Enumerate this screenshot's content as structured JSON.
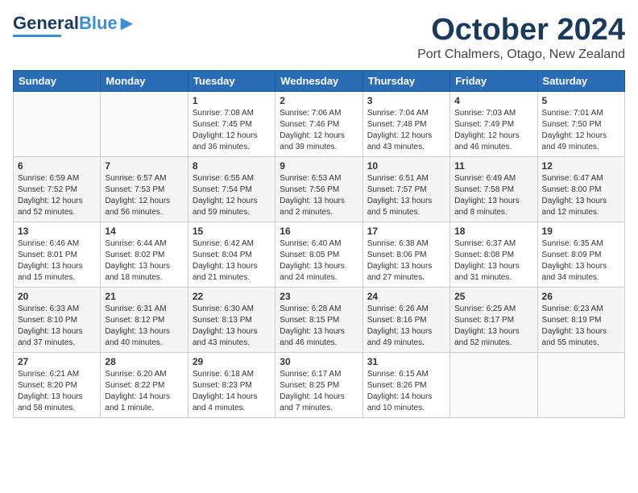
{
  "logo": {
    "general": "General",
    "blue": "Blue"
  },
  "title": "October 2024",
  "location": "Port Chalmers, Otago, New Zealand",
  "days_of_week": [
    "Sunday",
    "Monday",
    "Tuesday",
    "Wednesday",
    "Thursday",
    "Friday",
    "Saturday"
  ],
  "weeks": [
    [
      {
        "day": "",
        "info": ""
      },
      {
        "day": "",
        "info": ""
      },
      {
        "day": "1",
        "info": "Sunrise: 7:08 AM\nSunset: 7:45 PM\nDaylight: 12 hours\nand 36 minutes."
      },
      {
        "day": "2",
        "info": "Sunrise: 7:06 AM\nSunset: 7:46 PM\nDaylight: 12 hours\nand 39 minutes."
      },
      {
        "day": "3",
        "info": "Sunrise: 7:04 AM\nSunset: 7:48 PM\nDaylight: 12 hours\nand 43 minutes."
      },
      {
        "day": "4",
        "info": "Sunrise: 7:03 AM\nSunset: 7:49 PM\nDaylight: 12 hours\nand 46 minutes."
      },
      {
        "day": "5",
        "info": "Sunrise: 7:01 AM\nSunset: 7:50 PM\nDaylight: 12 hours\nand 49 minutes."
      }
    ],
    [
      {
        "day": "6",
        "info": "Sunrise: 6:59 AM\nSunset: 7:52 PM\nDaylight: 12 hours\nand 52 minutes."
      },
      {
        "day": "7",
        "info": "Sunrise: 6:57 AM\nSunset: 7:53 PM\nDaylight: 12 hours\nand 56 minutes."
      },
      {
        "day": "8",
        "info": "Sunrise: 6:55 AM\nSunset: 7:54 PM\nDaylight: 12 hours\nand 59 minutes."
      },
      {
        "day": "9",
        "info": "Sunrise: 6:53 AM\nSunset: 7:56 PM\nDaylight: 13 hours\nand 2 minutes."
      },
      {
        "day": "10",
        "info": "Sunrise: 6:51 AM\nSunset: 7:57 PM\nDaylight: 13 hours\nand 5 minutes."
      },
      {
        "day": "11",
        "info": "Sunrise: 6:49 AM\nSunset: 7:58 PM\nDaylight: 13 hours\nand 8 minutes."
      },
      {
        "day": "12",
        "info": "Sunrise: 6:47 AM\nSunset: 8:00 PM\nDaylight: 13 hours\nand 12 minutes."
      }
    ],
    [
      {
        "day": "13",
        "info": "Sunrise: 6:46 AM\nSunset: 8:01 PM\nDaylight: 13 hours\nand 15 minutes."
      },
      {
        "day": "14",
        "info": "Sunrise: 6:44 AM\nSunset: 8:02 PM\nDaylight: 13 hours\nand 18 minutes."
      },
      {
        "day": "15",
        "info": "Sunrise: 6:42 AM\nSunset: 8:04 PM\nDaylight: 13 hours\nand 21 minutes."
      },
      {
        "day": "16",
        "info": "Sunrise: 6:40 AM\nSunset: 8:05 PM\nDaylight: 13 hours\nand 24 minutes."
      },
      {
        "day": "17",
        "info": "Sunrise: 6:38 AM\nSunset: 8:06 PM\nDaylight: 13 hours\nand 27 minutes."
      },
      {
        "day": "18",
        "info": "Sunrise: 6:37 AM\nSunset: 8:08 PM\nDaylight: 13 hours\nand 31 minutes."
      },
      {
        "day": "19",
        "info": "Sunrise: 6:35 AM\nSunset: 8:09 PM\nDaylight: 13 hours\nand 34 minutes."
      }
    ],
    [
      {
        "day": "20",
        "info": "Sunrise: 6:33 AM\nSunset: 8:10 PM\nDaylight: 13 hours\nand 37 minutes."
      },
      {
        "day": "21",
        "info": "Sunrise: 6:31 AM\nSunset: 8:12 PM\nDaylight: 13 hours\nand 40 minutes."
      },
      {
        "day": "22",
        "info": "Sunrise: 6:30 AM\nSunset: 8:13 PM\nDaylight: 13 hours\nand 43 minutes."
      },
      {
        "day": "23",
        "info": "Sunrise: 6:28 AM\nSunset: 8:15 PM\nDaylight: 13 hours\nand 46 minutes."
      },
      {
        "day": "24",
        "info": "Sunrise: 6:26 AM\nSunset: 8:16 PM\nDaylight: 13 hours\nand 49 minutes."
      },
      {
        "day": "25",
        "info": "Sunrise: 6:25 AM\nSunset: 8:17 PM\nDaylight: 13 hours\nand 52 minutes."
      },
      {
        "day": "26",
        "info": "Sunrise: 6:23 AM\nSunset: 8:19 PM\nDaylight: 13 hours\nand 55 minutes."
      }
    ],
    [
      {
        "day": "27",
        "info": "Sunrise: 6:21 AM\nSunset: 8:20 PM\nDaylight: 13 hours\nand 58 minutes."
      },
      {
        "day": "28",
        "info": "Sunrise: 6:20 AM\nSunset: 8:22 PM\nDaylight: 14 hours\nand 1 minute."
      },
      {
        "day": "29",
        "info": "Sunrise: 6:18 AM\nSunset: 8:23 PM\nDaylight: 14 hours\nand 4 minutes."
      },
      {
        "day": "30",
        "info": "Sunrise: 6:17 AM\nSunset: 8:25 PM\nDaylight: 14 hours\nand 7 minutes."
      },
      {
        "day": "31",
        "info": "Sunrise: 6:15 AM\nSunset: 8:26 PM\nDaylight: 14 hours\nand 10 minutes."
      },
      {
        "day": "",
        "info": ""
      },
      {
        "day": "",
        "info": ""
      }
    ]
  ]
}
